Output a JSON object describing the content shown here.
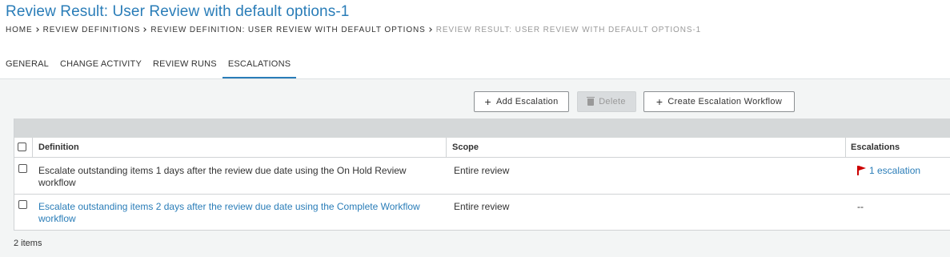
{
  "page": {
    "title": "Review Result: User Review with default options-1"
  },
  "breadcrumb": [
    "HOME",
    "REVIEW DEFINITIONS",
    "REVIEW DEFINITION: USER REVIEW WITH DEFAULT OPTIONS",
    "REVIEW RESULT: USER REVIEW WITH DEFAULT OPTIONS-1"
  ],
  "tabs": [
    {
      "label": "GENERAL",
      "active": false
    },
    {
      "label": "CHANGE ACTIVITY",
      "active": false
    },
    {
      "label": "REVIEW RUNS",
      "active": false
    },
    {
      "label": "ESCALATIONS",
      "active": true
    }
  ],
  "toolbar": {
    "add_label": "Add Escalation",
    "delete_label": "Delete",
    "create_label": "Create Escalation Workflow"
  },
  "table": {
    "columns": [
      "Definition",
      "Scope",
      "Escalations"
    ],
    "rows": [
      {
        "definition": "Escalate outstanding items 1 days after the review due date using the On Hold Review workflow",
        "scope": "Entire review",
        "escalations": "1 escalation"
      },
      {
        "definition": "Escalate outstanding items 2 days after the review due date using the Complete Workflow workflow",
        "scope": "Entire review",
        "escalations": "--"
      }
    ]
  },
  "footer": {
    "count": "2 items"
  },
  "colors": {
    "accent": "#2a7db8",
    "flag": "#cc0000"
  }
}
